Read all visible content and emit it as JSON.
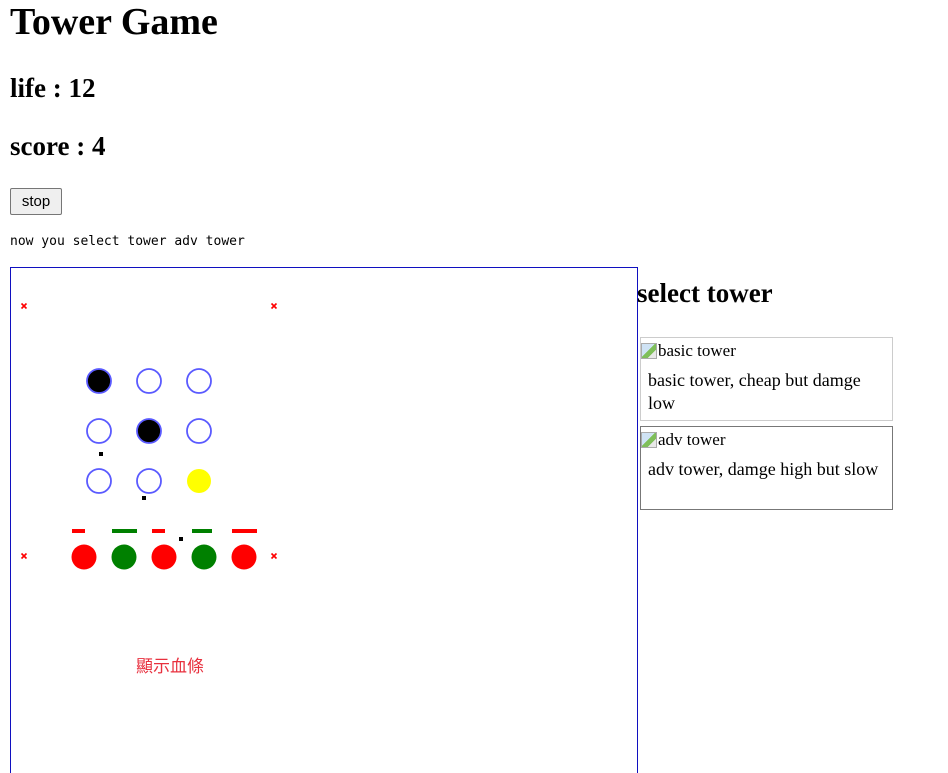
{
  "app": {
    "title": "Tower Game",
    "life_text": "life : 12",
    "score_text": "score : 4",
    "stop_label": "stop",
    "status_text": "now you select tower adv tower",
    "board_label": "顯示血條"
  },
  "sidebar": {
    "title": "select tower",
    "towers": [
      {
        "alt": "basic tower",
        "description": "basic tower, cheap but damge low"
      },
      {
        "alt": "adv tower",
        "description": "adv tower, damge high but slow"
      }
    ]
  },
  "colors": {
    "accent_blue": "#5a5aff",
    "tower_black": "#000000",
    "tower_yellow": "#ffff00",
    "enemy_red": "#ff0000",
    "enemy_green": "#008000",
    "marker_red": "#ff0000",
    "label_red": "#e8303e"
  },
  "board": {
    "slots": [
      "black",
      "empty",
      "empty",
      "empty",
      "black",
      "empty",
      "empty",
      "empty",
      "yellow"
    ],
    "enemies": [
      "red",
      "green",
      "red",
      "green",
      "red"
    ]
  }
}
